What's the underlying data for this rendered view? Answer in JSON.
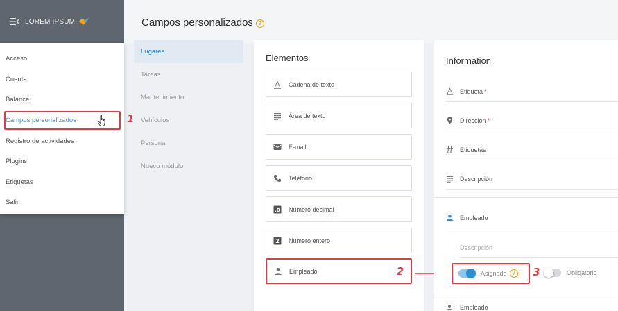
{
  "brand": {
    "name": "LOREM IPSUM",
    "menu_icon": "menu-collapse-icon",
    "logo_icon": "bird-logo-icon"
  },
  "menu": {
    "items": [
      {
        "label": "Acceso"
      },
      {
        "label": "Cuenta"
      },
      {
        "label": "Balance"
      },
      {
        "label": "Campos personalizados",
        "active": true
      },
      {
        "label": "Registro de actividades"
      },
      {
        "label": "Plugins"
      },
      {
        "label": "Etiquetas"
      },
      {
        "label": "Salir"
      }
    ]
  },
  "header": {
    "title": "Campos personalizados",
    "help": "?"
  },
  "subnav": {
    "items": [
      {
        "label": "Lugares",
        "active": true
      },
      {
        "label": "Tareas"
      },
      {
        "label": "Mantenimiento"
      },
      {
        "label": "Vehículos"
      },
      {
        "label": "Personal"
      },
      {
        "label": "Nuevo módulo"
      }
    ]
  },
  "elementos": {
    "title": "Elementos",
    "items": [
      {
        "label": "Cadena de texto",
        "icon": "text-string-icon"
      },
      {
        "label": "Área de texto",
        "icon": "text-area-icon"
      },
      {
        "label": "E-mail",
        "icon": "email-icon"
      },
      {
        "label": "Teléfono",
        "icon": "phone-icon"
      },
      {
        "label": "Número decimal",
        "icon": "decimal-number-icon"
      },
      {
        "label": "Número entero",
        "icon": "integer-number-icon"
      },
      {
        "label": "Empleado",
        "icon": "person-icon",
        "highlight": true
      }
    ]
  },
  "information": {
    "title": "Information",
    "fields": [
      {
        "label": "Etiqueta",
        "required": "*",
        "icon": "text-string-icon"
      },
      {
        "label": "Dirección",
        "required": "*",
        "icon": "location-pin-icon"
      },
      {
        "label": "Etiquetas",
        "required": "",
        "icon": "hashtag-icon"
      },
      {
        "label": "Descripción",
        "required": "",
        "icon": "text-area-icon"
      }
    ],
    "empleado": {
      "label": "Empleado",
      "icon": "person-icon"
    },
    "descripcion_placeholder": "Descripción",
    "toggles": {
      "asignado": {
        "label": "Asignado",
        "on": true,
        "help": "?"
      },
      "obligatorio": {
        "label": "Obligatorio",
        "on": false
      }
    },
    "bottom_label": "Empleado"
  },
  "callouts": {
    "one": "1",
    "two": "2",
    "three": "3"
  },
  "colors": {
    "accent": "#2b9ad7",
    "annotation": "#e03b44",
    "sidebar": "#5f666f",
    "help": "#f0a30a"
  }
}
